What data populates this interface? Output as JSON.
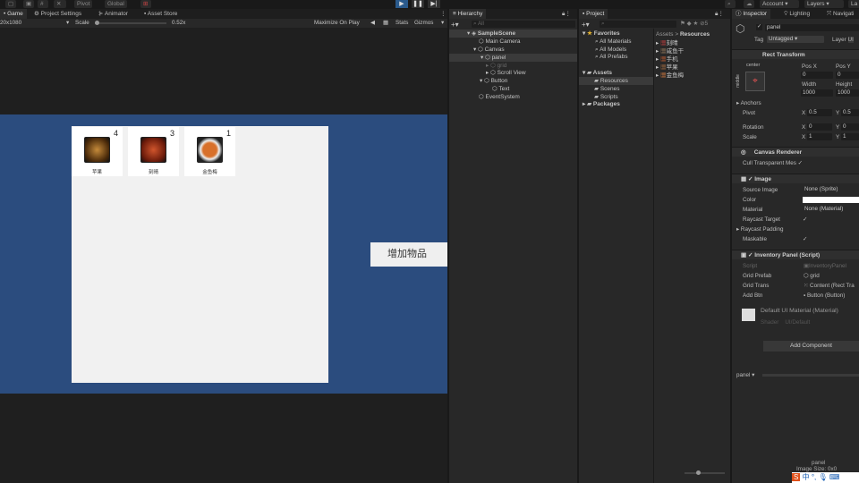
{
  "toolbar": {
    "pivot": "Pivot",
    "global": "Global",
    "account": "Account",
    "layers": "Layers",
    "layout": "La"
  },
  "game": {
    "tabs": [
      "Game",
      "Project Settings",
      "Animator",
      "Asset Store"
    ],
    "resolution": "20x1080",
    "scale_label": "Scale",
    "scale_value": "0.52x",
    "maximize": "Maximize On Play",
    "stats": "Stats",
    "gizmos": "Gizmos",
    "slots": [
      {
        "count": "4",
        "name": "苹果",
        "color": "#7a5a1f"
      },
      {
        "count": "3",
        "name": "刻晴",
        "color": "#8b2a14"
      },
      {
        "count": "1",
        "name": "金鱼梅",
        "color": "#b85a1e"
      }
    ],
    "add_button": "增加物品",
    "canvas_color": "#2b4c7e"
  },
  "hierarchy": {
    "title": "Hierarchy",
    "search": "All",
    "items": [
      "SampleScene",
      "Main Camera",
      "Canvas",
      "panel",
      "grid",
      "Scroll View",
      "Button",
      "Text",
      "EventSystem"
    ]
  },
  "project": {
    "title": "Project",
    "favorites": "Favorites",
    "fav_items": [
      "All Materials",
      "All Models",
      "All Prefabs"
    ],
    "assets": "Assets",
    "folders": [
      "Resources",
      "Scenes",
      "Scripts"
    ],
    "packages": "Packages",
    "breadcrumb": [
      "Assets",
      "Resources"
    ],
    "files": [
      "刻晴",
      "咸鱼干",
      "手机",
      "苹果",
      "金鱼梅"
    ],
    "hidden_count": "5"
  },
  "inspector": {
    "tabs": [
      "Inspector",
      "Lighting",
      "Navigati"
    ],
    "object_name": "panel",
    "tag_label": "Tag",
    "tag": "Untagged",
    "layer_label": "Layer",
    "layer": "UI",
    "rect": {
      "title": "Rect Transform",
      "anchor": "center",
      "anchor_side": "middle",
      "posx_label": "Pos X",
      "posy_label": "Pos Y",
      "posx": "0",
      "posy": "0",
      "width_label": "Width",
      "height_label": "Height",
      "width": "1000",
      "height": "1000",
      "anchors": "Anchors",
      "pivot": "Pivot",
      "pivot_x": "0.5",
      "pivot_y": "0.5",
      "rotation": "Rotation",
      "rot_x": "0",
      "rot_y": "0",
      "scale": "Scale",
      "scale_x": "1",
      "scale_y": "1",
      "x": "X",
      "y": "Y"
    },
    "canvas_renderer": {
      "title": "Canvas Renderer",
      "cull": "Cull Transparent Mes"
    },
    "image": {
      "title": "Image",
      "source_label": "Source Image",
      "source": "None (Sprite)",
      "color_label": "Color",
      "material_label": "Material",
      "material": "None (Material)",
      "raycast": "Raycast Target",
      "padding": "Raycast Padding",
      "maskable": "Maskable"
    },
    "script": {
      "title": "Inventory Panel (Script)",
      "script_label": "Script",
      "script": "InventoryPanel",
      "grid_prefab_label": "Grid Prefab",
      "grid_prefab": "grid",
      "grid_trans_label": "Grid Trans",
      "grid_trans": "Content (Rect Tra",
      "add_btn_label": "Add Btn",
      "add_btn": "Button (Button)"
    },
    "material": {
      "title": "Default UI Material (Material)",
      "shader_label": "Shader",
      "shader": "UI/Default"
    },
    "add_component": "Add Component",
    "preview_label": "panel",
    "preview_name": "panel",
    "preview_size": "Image Size: 0x0"
  },
  "taskbar": {
    "ime": "中"
  }
}
